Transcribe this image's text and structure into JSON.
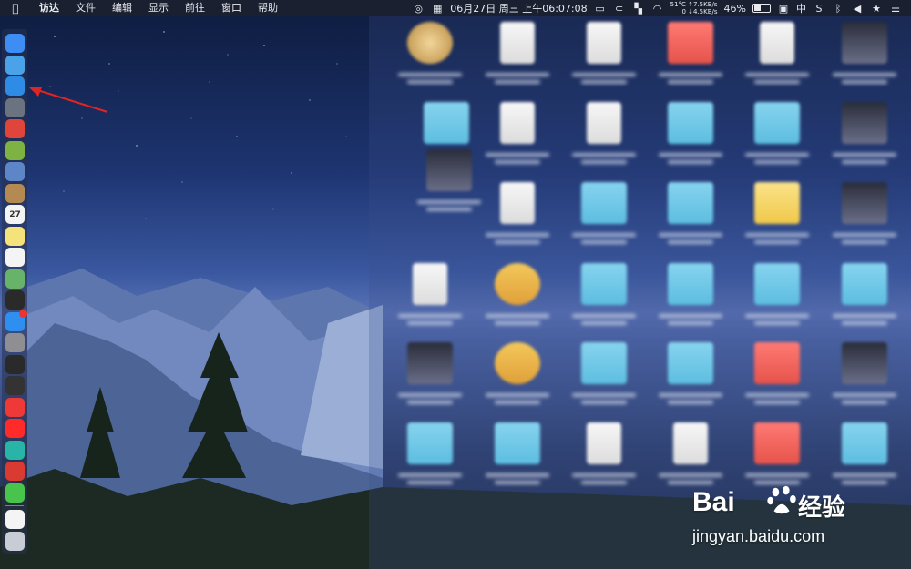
{
  "menubar": {
    "app_name": "访达",
    "menus": [
      "文件",
      "编辑",
      "显示",
      "前往",
      "窗口",
      "帮助"
    ],
    "datetime": "06月27日 周三 上午06:07:08",
    "cpu_temp": "51°C",
    "net_up": "↑7.5KB/s",
    "net_down_prefix": "0",
    "net_down": "↓4.5KB/s",
    "battery_percent": "46%",
    "battery_level": 0.46,
    "input_method": "中"
  },
  "dock": {
    "icons": [
      {
        "name": "finder-icon",
        "color": "#3d8df5"
      },
      {
        "name": "siri-icon",
        "color": "#4aa3e8"
      },
      {
        "name": "safari-icon",
        "color": "#2e8ce6"
      },
      {
        "name": "launchpad-icon",
        "color": "#6b7280"
      },
      {
        "name": "app-red-icon",
        "color": "#e0453b"
      },
      {
        "name": "android-icon",
        "color": "#7cb342"
      },
      {
        "name": "preview-icon",
        "color": "#5c86c8"
      },
      {
        "name": "notes-brown-icon",
        "color": "#b48a52"
      },
      {
        "name": "calendar-icon",
        "color": "#f4f4f4",
        "label": "27"
      },
      {
        "name": "notes-icon",
        "color": "#f6e27a"
      },
      {
        "name": "reminders-icon",
        "color": "#f4f4f4"
      },
      {
        "name": "maps-icon",
        "color": "#68b36a"
      },
      {
        "name": "terminal-icon",
        "color": "#2a2a2a"
      },
      {
        "name": "app-store-icon",
        "color": "#2f8ff0"
      },
      {
        "name": "system-preferences-icon",
        "color": "#8e8e93"
      },
      {
        "name": "activity-monitor-icon",
        "color": "#2a2a2a"
      },
      {
        "name": "console-icon",
        "color": "#333333"
      },
      {
        "name": "vivaldi-icon",
        "color": "#ef3939"
      },
      {
        "name": "yandex-icon",
        "color": "#ff2a2a"
      },
      {
        "name": "teal-app-icon",
        "color": "#28b5a8"
      },
      {
        "name": "netease-music-icon",
        "color": "#d93a31"
      },
      {
        "name": "wechat-icon",
        "color": "#48c34c"
      },
      {
        "name": "document-icon",
        "color": "#f4f4f4"
      },
      {
        "name": "trash-icon",
        "color": "#c8ccd4"
      }
    ]
  },
  "watermark": {
    "brand": "Bai",
    "brand2": "经验",
    "url": "jingyan.baidu.com"
  }
}
